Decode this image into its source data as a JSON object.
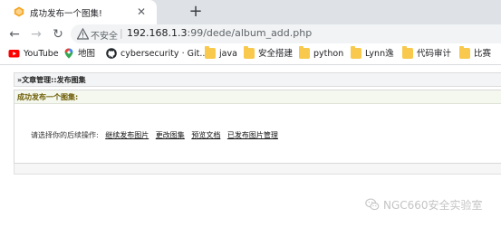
{
  "browser": {
    "tab": {
      "title": "成功发布一个图集!",
      "close_glyph": "✕",
      "favicon": "dedecms-favicon-icon"
    },
    "new_tab_glyph": "+",
    "nav": {
      "back_glyph": "←",
      "forward_glyph": "→",
      "reload_glyph": "↻"
    },
    "omnibox": {
      "security_label": "不安全",
      "separator": "|",
      "url_host": "192.168.1.3",
      "url_rest": ":99/dede/album_add.php"
    },
    "bookmarks": [
      {
        "label": "YouTube",
        "icon": "youtube-icon"
      },
      {
        "label": "地图",
        "icon": "maps-pin-icon"
      },
      {
        "label": "cybersecurity · Git...",
        "icon": "github-icon"
      },
      {
        "label": "java",
        "icon": "folder-icon"
      },
      {
        "label": "安全搭建",
        "icon": "folder-icon"
      },
      {
        "label": "python",
        "icon": "folder-icon"
      },
      {
        "label": "Lynn逸",
        "icon": "folder-icon"
      },
      {
        "label": "代码审计",
        "icon": "folder-icon"
      },
      {
        "label": "比赛",
        "icon": "folder-icon"
      }
    ]
  },
  "page": {
    "breadcrumb": "»文章管理::发布图集",
    "panel_title": "成功发布一个图集:",
    "prompt": "请选择你的后续操作:",
    "actions": [
      "继续发布图片",
      "更改图集",
      "预览文档",
      "已发布图片管理"
    ]
  },
  "watermark": {
    "text": "NGC660安全实验室",
    "icon": "wechat-icon"
  },
  "colors": {
    "tabstrip": "#dee1e6",
    "omnibox": "#f1f3f4",
    "panel_head_text": "#6b5a00",
    "folder": "#f8c94c",
    "youtube": "#ff0000"
  }
}
